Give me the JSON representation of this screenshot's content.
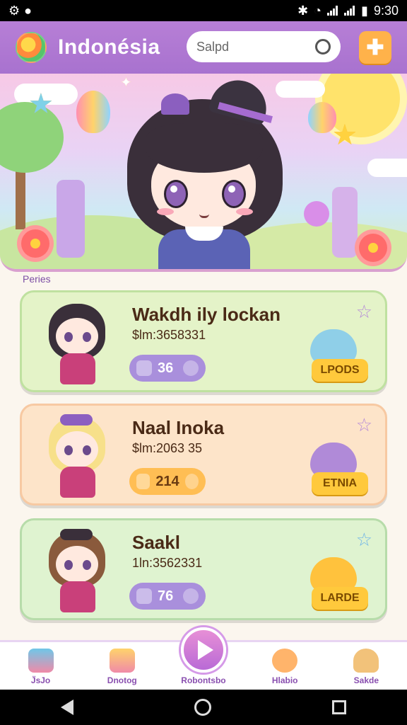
{
  "status_bar": {
    "time": "9:30"
  },
  "header": {
    "title": "Indonésia",
    "search": {
      "value": "Salpd"
    }
  },
  "section_label": "Peries",
  "cards": [
    {
      "title": "Wakdh ily lockan",
      "subtitle": "$lm:3658331",
      "stat": "36",
      "tag": "LPODS"
    },
    {
      "title": "Naal Inoka",
      "subtitle": "$lm:2063 35",
      "stat": "214",
      "tag": "ETNIA"
    },
    {
      "title": "Saakl",
      "subtitle": "1ln:3562331",
      "stat": "76",
      "tag": "LARDE"
    }
  ],
  "bottom_nav": [
    {
      "label": "J̈sJo",
      "icon": "house-icon"
    },
    {
      "label": "Dnotog",
      "icon": "rainbow-house-icon"
    },
    {
      "label": "Robontsbo",
      "icon": "play-icon"
    },
    {
      "label": "Hlabio",
      "icon": "character-icon"
    },
    {
      "label": "Sakde",
      "icon": "bread-icon"
    }
  ],
  "colors": {
    "header": "#b77fd6",
    "accent": "#ffb24a",
    "card1": "#e4f3c8",
    "card2": "#fde4c9",
    "card3": "#dff3d0"
  }
}
